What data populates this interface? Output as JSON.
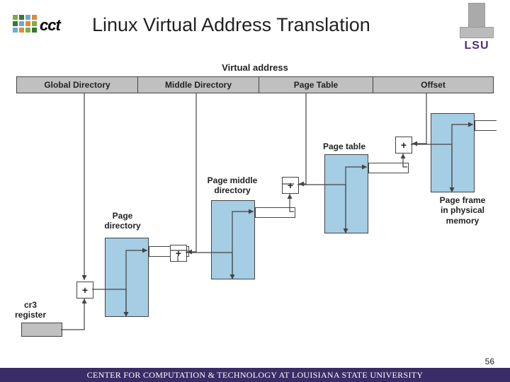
{
  "slide": {
    "title": "Linux Virtual Address Translation",
    "page_number": "56",
    "footer": "CENTER FOR COMPUTATION & TECHNOLOGY AT LOUISIANA STATE UNIVERSITY"
  },
  "logos": {
    "cct": "cct",
    "lsu": "LSU"
  },
  "diagram": {
    "va_title": "Virtual address",
    "segments": {
      "global": "Global Directory",
      "middle": "Middle Directory",
      "pagetable": "Page Table",
      "offset": "Offset"
    },
    "labels": {
      "cr3": "cr3\nregister",
      "page_dir": "Page\ndirectory",
      "page_mid": "Page middle\ndirectory",
      "page_table": "Page table",
      "page_frame": "Page frame\nin physical\nmemory"
    },
    "plus": "+"
  }
}
